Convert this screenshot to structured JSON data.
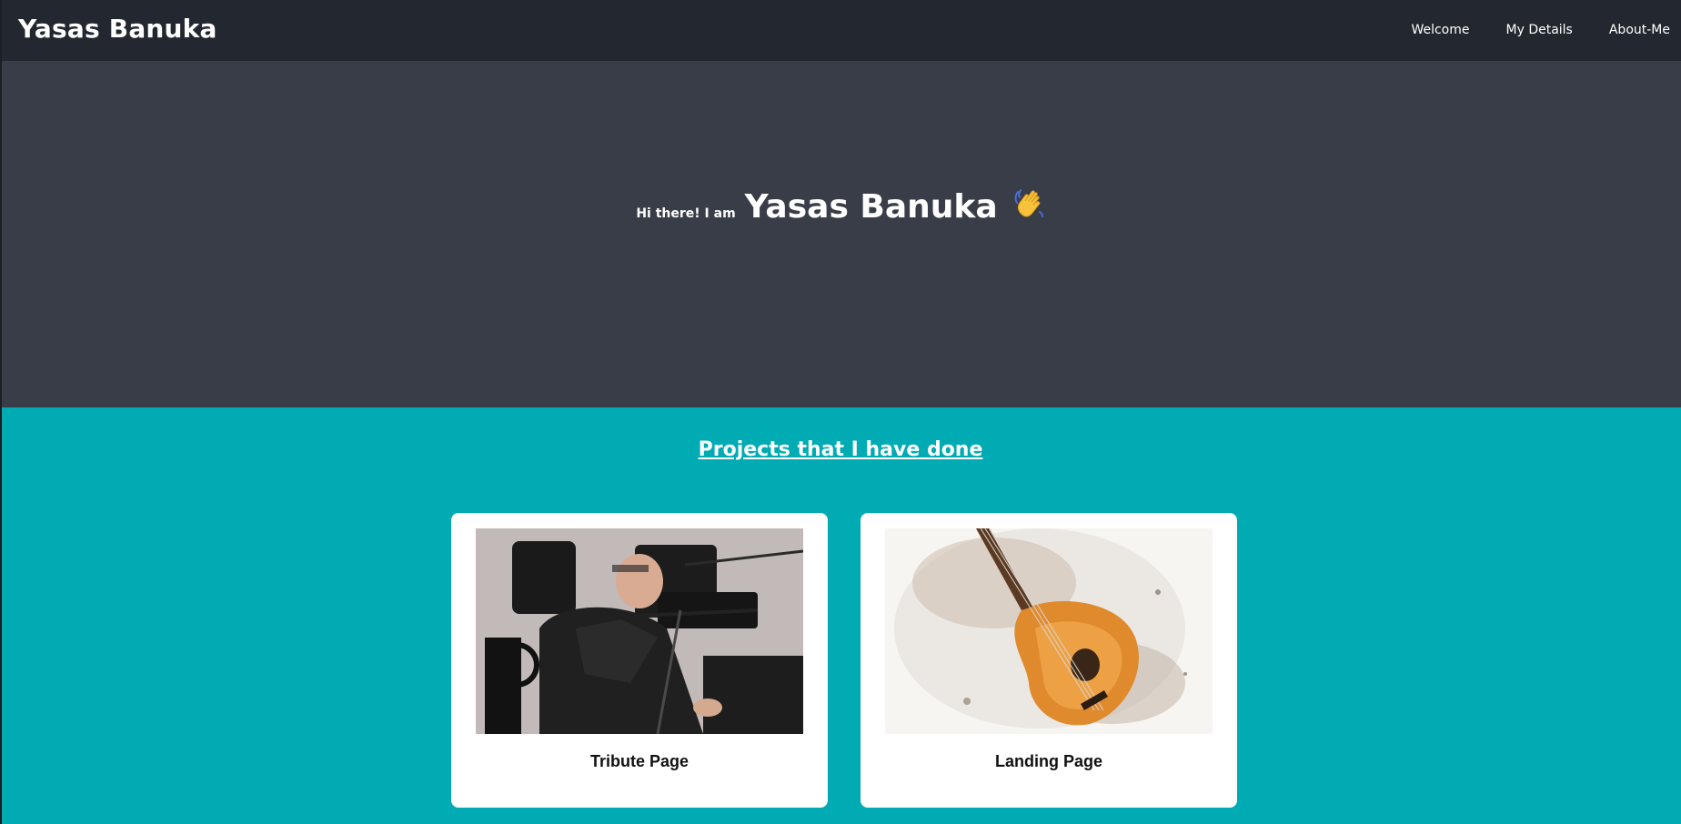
{
  "navbar": {
    "brand": "Yasas Banuka",
    "links": [
      {
        "label": "Welcome"
      },
      {
        "label": "My Details"
      },
      {
        "label": "About-Me"
      }
    ]
  },
  "hero": {
    "greeting": "Hi there! I am",
    "name": "Yasas Banuka",
    "emoji": "👋"
  },
  "projects": {
    "title": "Projects that I have done",
    "cards": [
      {
        "title": "Tribute Page",
        "image": "photo-of-man-in-wheelchair"
      },
      {
        "title": "Landing Page",
        "image": "watercolor-acoustic-guitar"
      }
    ]
  },
  "colors": {
    "navbar_bg": "#23272f",
    "hero_bg": "#393d47",
    "projects_bg": "#00abb4",
    "card_bg": "#ffffff"
  }
}
